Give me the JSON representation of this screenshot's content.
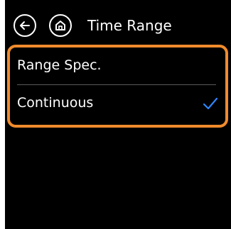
{
  "header": {
    "title": "Time Range",
    "back_icon": "arrow-left-icon",
    "home_icon": "home-icon"
  },
  "options": [
    {
      "label": "Range Spec.",
      "selected": false
    },
    {
      "label": "Continuous",
      "selected": true
    }
  ],
  "colors": {
    "background": "#000000",
    "frame_border": "#f08b2c",
    "check": "#2f86ff",
    "text": "#ffffff"
  }
}
